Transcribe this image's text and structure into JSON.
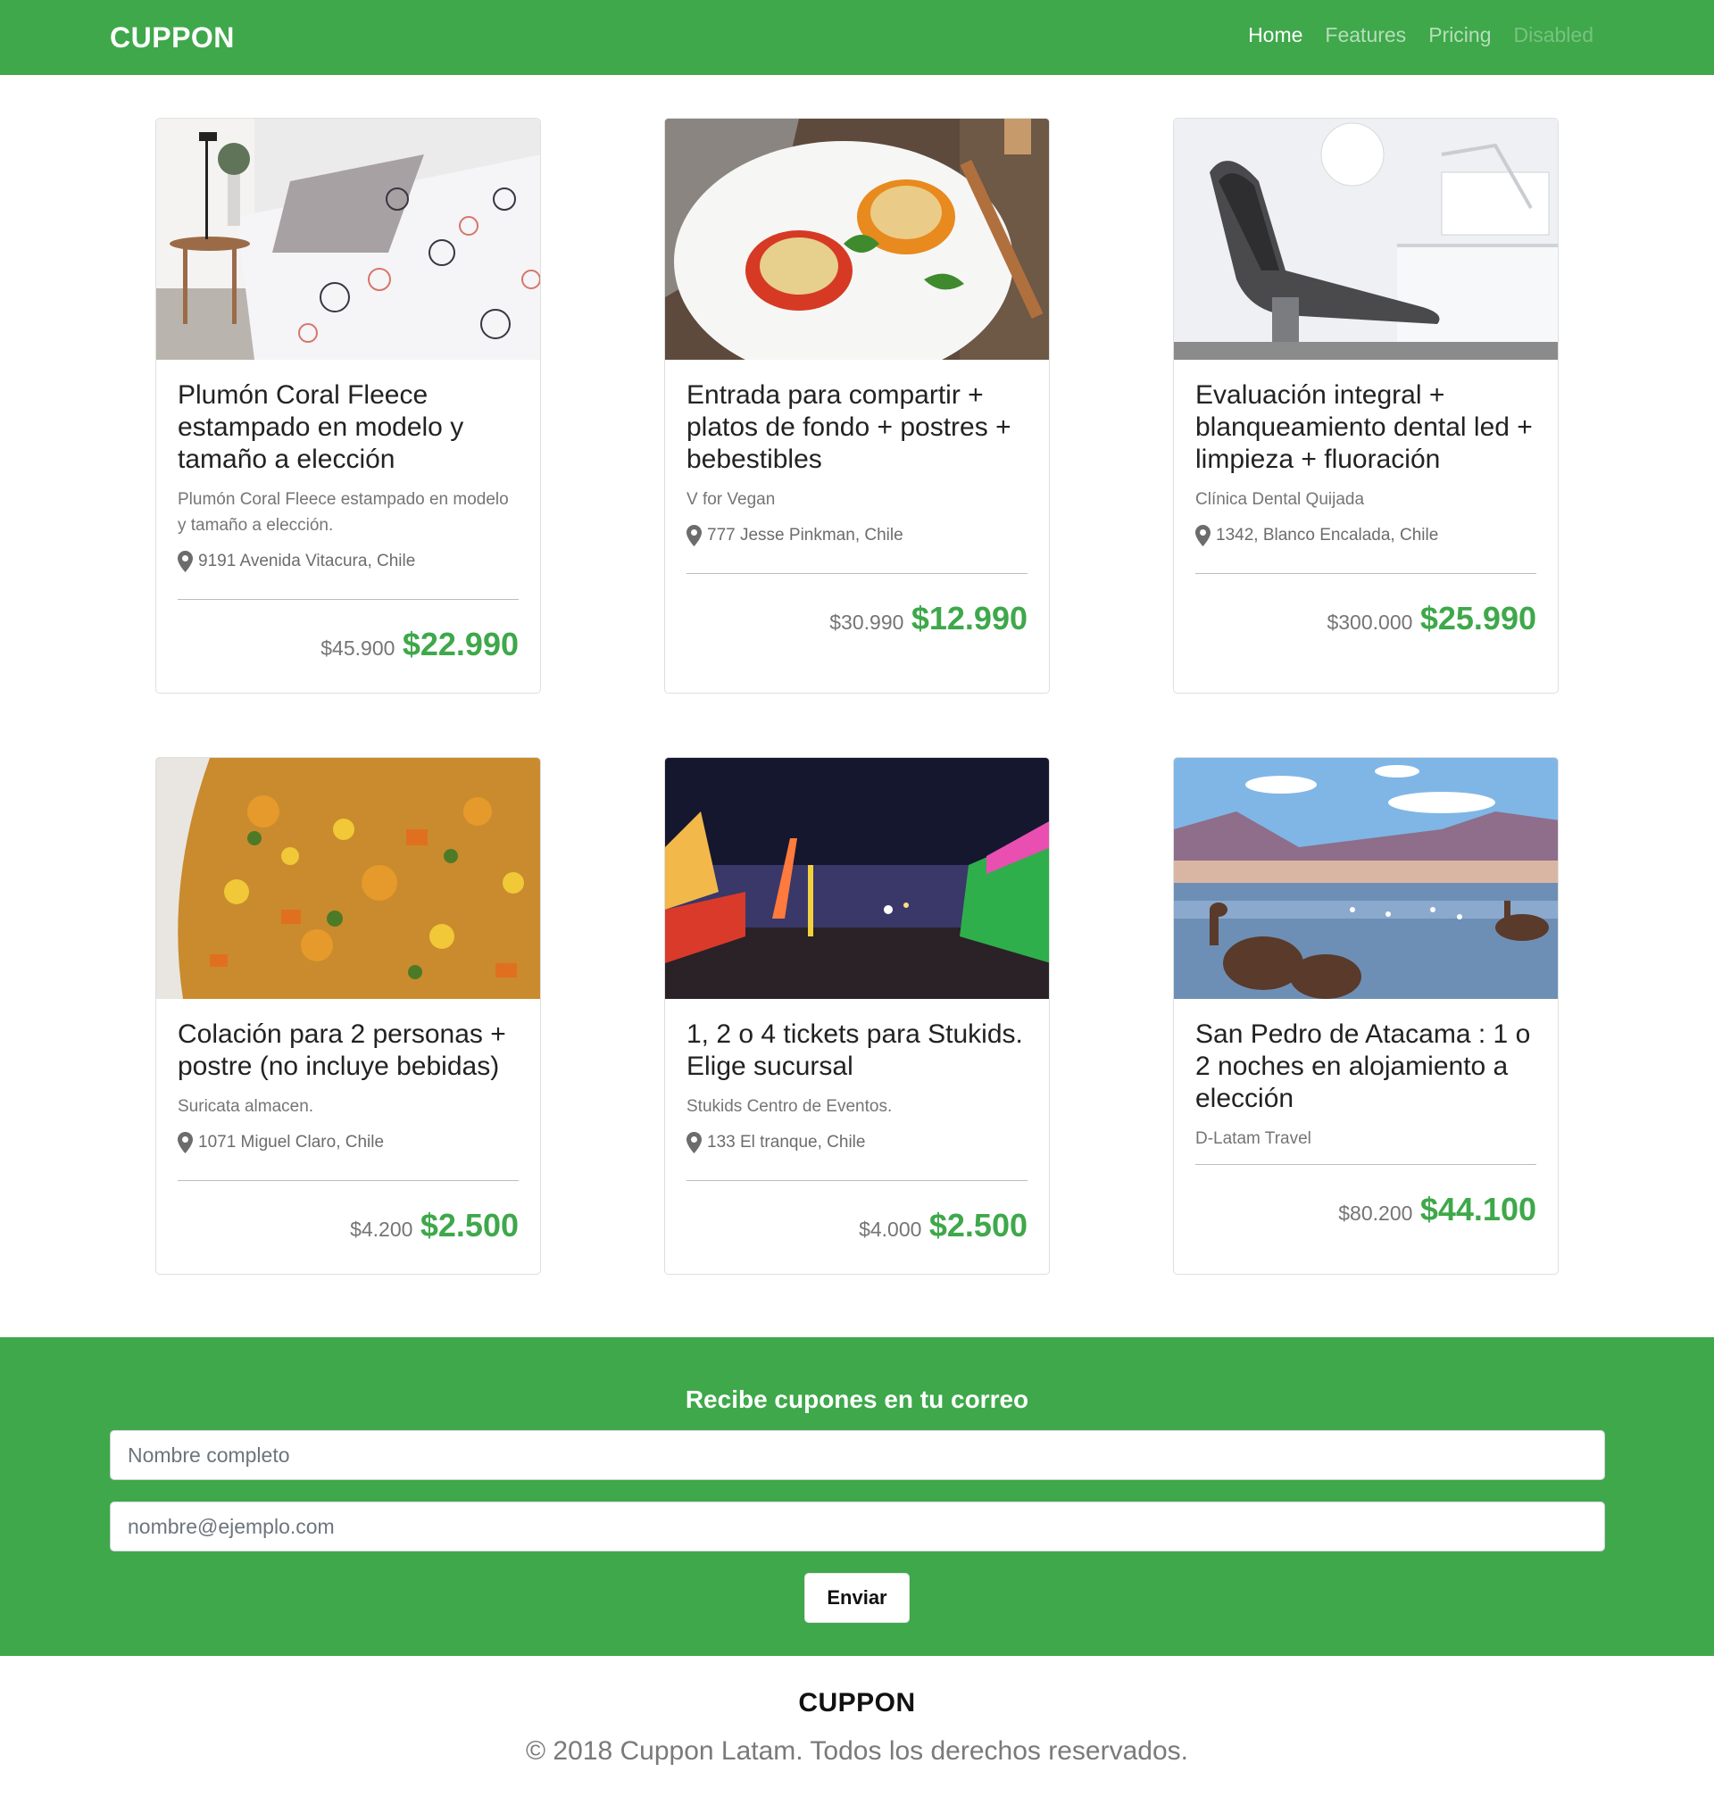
{
  "navbar": {
    "brand": "CUPPON",
    "links": [
      {
        "label": "Home"
      },
      {
        "label": "Features"
      },
      {
        "label": "Pricing"
      },
      {
        "label": "Disabled"
      }
    ]
  },
  "deals": [
    {
      "title": "Plumón Coral Fleece estampado en modelo y tamaño a elección",
      "subtitle": "Plumón Coral Fleece estampado en modelo y tamaño a elección.",
      "location": "9191 Avenida Vitacura, Chile",
      "price_old": "$45.900",
      "price_new": "$22.990"
    },
    {
      "title": "Entrada para compartir + platos de fondo + postres + bebestibles",
      "subtitle": "V for Vegan",
      "location": "777 Jesse Pinkman, Chile",
      "price_old": "$30.990",
      "price_new": "$12.990"
    },
    {
      "title": "Evaluación integral + blanqueamiento dental led + limpieza + fluoración",
      "subtitle": "Clínica Dental Quijada",
      "location": "1342, Blanco Encalada, Chile",
      "price_old": "$300.000",
      "price_new": "$25.990"
    },
    {
      "title": "Colación para 2 personas + postre (no incluye bebidas)",
      "subtitle": "Suricata almacen.",
      "location": "1071 Miguel Claro, Chile",
      "price_old": "$4.200",
      "price_new": "$2.500"
    },
    {
      "title": "1, 2 o 4 tickets para Stukids. Elige sucursal",
      "subtitle": "Stukids Centro de Eventos.",
      "location": "133 El tranque, Chile",
      "price_old": "$4.000",
      "price_new": "$2.500"
    },
    {
      "title": "San Pedro de Atacama : 1 o 2 noches en alojamiento a elección",
      "subtitle": "D-Latam Travel",
      "price_old": "$80.200",
      "price_new": "$44.100"
    }
  ],
  "newsletter": {
    "title": "Recibe cupones en tu correo",
    "name_placeholder": "Nombre completo",
    "email_placeholder": "nombre@ejemplo.com",
    "submit_label": "Enviar"
  },
  "footer": {
    "brand": "CUPPON",
    "copyright": "© 2018 Cuppon Latam. Todos los derechos reservados."
  },
  "colors": {
    "brand_green": "#3ea84a",
    "price_green": "#3ea84a"
  }
}
